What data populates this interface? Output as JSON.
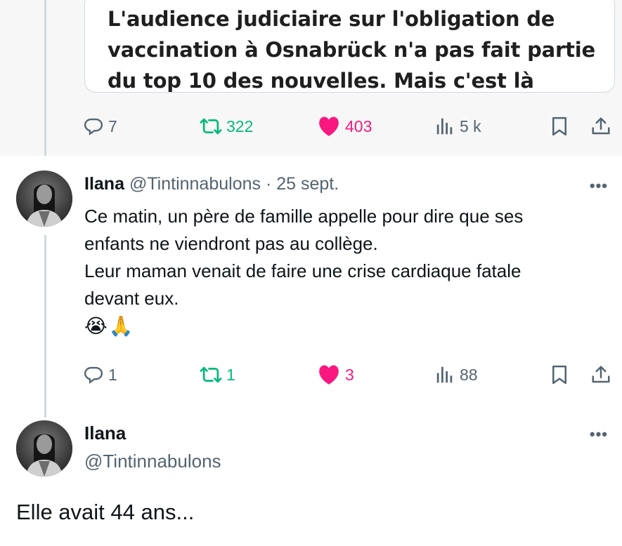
{
  "quoted_card": {
    "lines": [
      "L'audience judiciaire sur l'obligation de",
      "vaccination à Osnabrück n'a pas fait partie",
      "du top 10 des nouvelles. Mais c'est là"
    ]
  },
  "parent_actions": {
    "replies": "7",
    "reposts": "322",
    "likes": "403",
    "views": "5 k"
  },
  "reply_tweet": {
    "name": "Ilana",
    "handle": "@Tintinnabulons",
    "separator": "·",
    "date": "25 sept.",
    "more": "•••",
    "lines": [
      "Ce matin, un père de famille appelle pour dire que ses",
      "enfants ne viendront pas au collège.",
      "Leur maman venait de faire une crise cardiaque fatale",
      "devant eux.",
      "😭🙏"
    ],
    "actions": {
      "replies": "1",
      "reposts": "1",
      "likes": "3",
      "views": "88"
    }
  },
  "main_tweet": {
    "name": "Ilana",
    "handle": "@Tintinnabulons",
    "more": "•••",
    "text": "Elle avait 44 ans..."
  },
  "icons": {
    "reply": "reply-icon",
    "repost": "repost-icon",
    "like": "heart-icon",
    "views": "views-icon",
    "bookmark": "bookmark-icon",
    "share": "share-icon"
  },
  "colors": {
    "repost": "#00ba7c",
    "like": "#f91880",
    "muted": "#536471",
    "text": "#0f1419"
  }
}
